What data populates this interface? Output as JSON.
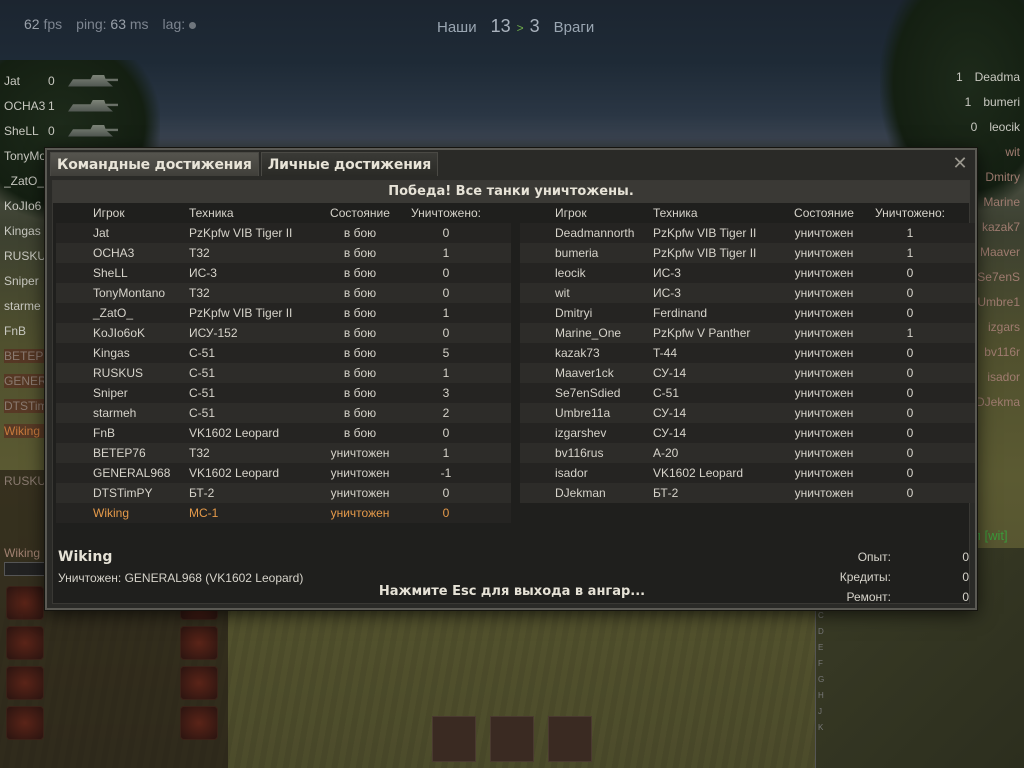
{
  "hud": {
    "fps_value": "62",
    "fps_label": "fps",
    "ping_label": "ping:",
    "ping_value": "63",
    "ping_unit": "ms",
    "lag_label": "lag:",
    "score_allies_label": "Наши",
    "score_allies": "13",
    "score_enemies": "3",
    "score_enemies_label": "Враги",
    "top_right_red": "",
    "score_arrow": ">"
  },
  "allies": [
    {
      "name": "Jat",
      "kills": "0",
      "tank": true,
      "dead": false
    },
    {
      "name": "OCHA3",
      "kills": "1",
      "tank": true,
      "dead": false
    },
    {
      "name": "SheLL",
      "kills": "0",
      "tank": true,
      "dead": false
    },
    {
      "name": "TonyMo",
      "kills": "",
      "tank": false,
      "dead": false
    },
    {
      "name": "_ZatO_",
      "kills": "",
      "tank": false,
      "dead": false
    },
    {
      "name": "KoJIo6",
      "kills": "",
      "tank": false,
      "dead": false
    },
    {
      "name": "Kingas",
      "kills": "",
      "tank": false,
      "dead": false
    },
    {
      "name": "RUSKUS",
      "kills": "",
      "tank": false,
      "dead": false
    },
    {
      "name": "Sniper",
      "kills": "",
      "tank": false,
      "dead": false
    },
    {
      "name": "starme",
      "kills": "",
      "tank": false,
      "dead": false
    },
    {
      "name": "FnB",
      "kills": "",
      "tank": false,
      "dead": false
    },
    {
      "name": "BETEP7",
      "kills": "",
      "tank": false,
      "dead": true
    },
    {
      "name": "GENERA",
      "kills": "",
      "tank": false,
      "dead": true
    },
    {
      "name": "DTSTim",
      "kills": "",
      "tank": false,
      "dead": true
    },
    {
      "name": "Wiking",
      "kills": "",
      "tank": false,
      "dead": true,
      "me": true
    }
  ],
  "enemies": [
    {
      "kills": "1",
      "name": "Deadma"
    },
    {
      "kills": "1",
      "name": "bumeri"
    },
    {
      "kills": "0",
      "name": "leocik"
    },
    {
      "kills": "",
      "name": "wit"
    },
    {
      "kills": "",
      "name": "Dmitry"
    },
    {
      "kills": "",
      "name": "Marine"
    },
    {
      "kills": "",
      "name": "kazak7"
    },
    {
      "kills": "",
      "name": "Maaver"
    },
    {
      "kills": "",
      "name": "Se7enS"
    },
    {
      "kills": "",
      "name": "Umbre1"
    },
    {
      "kills": "",
      "name": "izgars"
    },
    {
      "kills": "",
      "name": "bv116r"
    },
    {
      "kills": "",
      "name": "isador"
    },
    {
      "kills": "",
      "name": "DJekma"
    }
  ],
  "left_panel": {
    "rusk_label": "RUSKUS",
    "wiking_label": "Wiking"
  },
  "minimap": {
    "status_text": "ил [wit]",
    "ticks": [
      "C",
      "D",
      "E",
      "F",
      "G",
      "H",
      "J",
      "K"
    ]
  },
  "modal": {
    "tabs": [
      "Командные достижения",
      "Личные достижения"
    ],
    "close_glyph": "✕",
    "result_title": "Победа! Все танки уничтожены.",
    "headers": {
      "player": "Игрок",
      "vehicle": "Техника",
      "state": "Состояние",
      "kills": "Уничтожено:"
    },
    "team_left": [
      {
        "player": "Jat",
        "vehicle": "PzKpfw VIB Tiger II",
        "state": "в бою",
        "kills": "0"
      },
      {
        "player": "OCHA3",
        "vehicle": "T32",
        "state": "в бою",
        "kills": "1"
      },
      {
        "player": "SheLL",
        "vehicle": "ИС-3",
        "state": "в бою",
        "kills": "0"
      },
      {
        "player": "TonyMontano",
        "vehicle": "T32",
        "state": "в бою",
        "kills": "0"
      },
      {
        "player": "_ZatO_",
        "vehicle": "PzKpfw VIB Tiger II",
        "state": "в бою",
        "kills": "1"
      },
      {
        "player": "KoJIo6oK",
        "vehicle": "ИСУ-152",
        "state": "в бою",
        "kills": "0"
      },
      {
        "player": "Kingas",
        "vehicle": "С-51",
        "state": "в бою",
        "kills": "5"
      },
      {
        "player": "RUSKUS",
        "vehicle": "С-51",
        "state": "в бою",
        "kills": "1"
      },
      {
        "player": "Sniper",
        "vehicle": "С-51",
        "state": "в бою",
        "kills": "3"
      },
      {
        "player": "starmeh",
        "vehicle": "С-51",
        "state": "в бою",
        "kills": "2"
      },
      {
        "player": "FnB",
        "vehicle": "VK1602 Leopard",
        "state": "в бою",
        "kills": "0"
      },
      {
        "player": "BETEP76",
        "vehicle": "T32",
        "state": "уничтожен",
        "kills": "1"
      },
      {
        "player": "GENERAL968",
        "vehicle": "VK1602 Leopard",
        "state": "уничтожен",
        "kills": "-1"
      },
      {
        "player": "DTSTimPY",
        "vehicle": "БТ-2",
        "state": "уничтожен",
        "kills": "0"
      },
      {
        "player": "Wiking",
        "vehicle": "МС-1",
        "state": "уничтожен",
        "kills": "0",
        "me": true
      }
    ],
    "team_right": [
      {
        "player": "Deadmannorth",
        "vehicle": "PzKpfw VIB Tiger II",
        "state": "уничтожен",
        "kills": "1"
      },
      {
        "player": "bumeria",
        "vehicle": "PzKpfw VIB Tiger II",
        "state": "уничтожен",
        "kills": "1"
      },
      {
        "player": "leocik",
        "vehicle": "ИС-3",
        "state": "уничтожен",
        "kills": "0"
      },
      {
        "player": "wit",
        "vehicle": "ИС-3",
        "state": "уничтожен",
        "kills": "0"
      },
      {
        "player": "Dmitryi",
        "vehicle": "Ferdinand",
        "state": "уничтожен",
        "kills": "0"
      },
      {
        "player": "Marine_One",
        "vehicle": "PzKpfw V Panther",
        "state": "уничтожен",
        "kills": "1"
      },
      {
        "player": "kazak73",
        "vehicle": "T-44",
        "state": "уничтожен",
        "kills": "0"
      },
      {
        "player": "Maaver1ck",
        "vehicle": "СУ-14",
        "state": "уничтожен",
        "kills": "0"
      },
      {
        "player": "Se7enSdied",
        "vehicle": "С-51",
        "state": "уничтожен",
        "kills": "0"
      },
      {
        "player": "Umbre11a",
        "vehicle": "СУ-14",
        "state": "уничтожен",
        "kills": "0"
      },
      {
        "player": "izgarshev",
        "vehicle": "СУ-14",
        "state": "уничтожен",
        "kills": "0"
      },
      {
        "player": "bv116rus",
        "vehicle": "А-20",
        "state": "уничтожен",
        "kills": "0"
      },
      {
        "player": "isador",
        "vehicle": "VK1602 Leopard",
        "state": "уничтожен",
        "kills": "0"
      },
      {
        "player": "DJekman",
        "vehicle": "БТ-2",
        "state": "уничтожен",
        "kills": "0"
      }
    ],
    "player_name": "Wiking",
    "death_info": "Уничтожен: GENERAL968 (VK1602 Leopard)",
    "esc_hint": "Нажмите Esc для выхода в ангар...",
    "stats": [
      {
        "label": "Опыт:",
        "value": "0"
      },
      {
        "label": "Кредиты:",
        "value": "0"
      },
      {
        "label": "Ремонт:",
        "value": "0"
      }
    ]
  },
  "colors": {
    "accent_orange": "#e59a4a",
    "victory_green": "#6fae4a",
    "red_tag": "#b22222"
  }
}
